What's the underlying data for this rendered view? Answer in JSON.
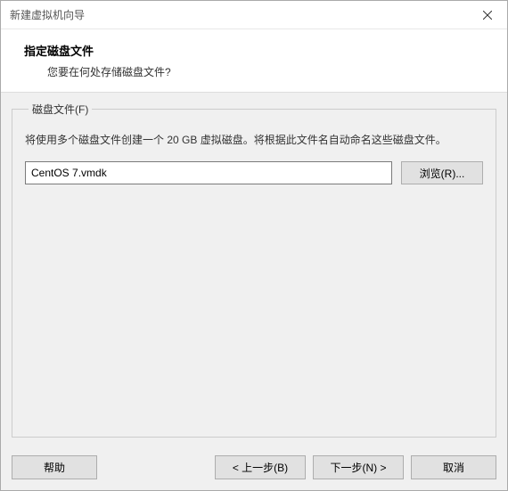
{
  "titlebar": {
    "title": "新建虚拟机向导"
  },
  "header": {
    "heading": "指定磁盘文件",
    "subheading": "您要在何处存储磁盘文件?"
  },
  "group": {
    "legend": "磁盘文件(F)",
    "description": "将使用多个磁盘文件创建一个 20 GB 虚拟磁盘。将根据此文件名自动命名这些磁盘文件。",
    "filename": "CentOS 7.vmdk",
    "browse_label": "浏览(R)..."
  },
  "footer": {
    "help_label": "帮助",
    "back_label": "< 上一步(B)",
    "next_label": "下一步(N) >",
    "cancel_label": "取消"
  }
}
